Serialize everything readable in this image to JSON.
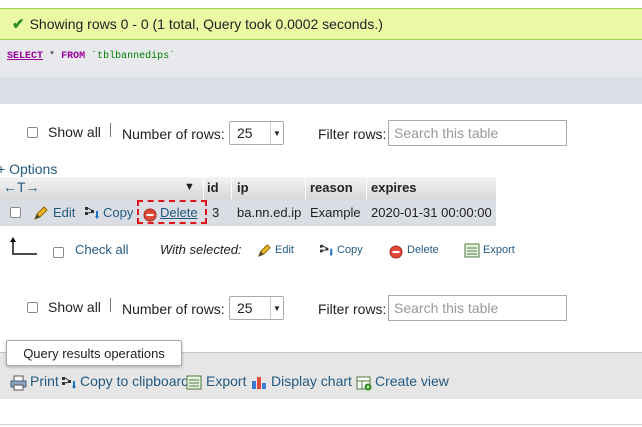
{
  "message": {
    "text": "Showing rows 0 - 0 (1 total, Query took 0.0002 seconds.)"
  },
  "sql": {
    "select": "SELECT",
    "star": "*",
    "from": "FROM",
    "table": "`tblbannedips`"
  },
  "controls_top": {
    "show_all": "Show all",
    "rows_label": "Number of rows:",
    "rows_value": "25",
    "filter_label": "Filter rows:",
    "search_placeholder": "Search this table"
  },
  "options_link": "+ Options",
  "table": {
    "sort_nav": "←T→",
    "columns": [
      "id",
      "ip",
      "reason",
      "expires"
    ],
    "row": {
      "edit": "Edit",
      "copy": "Copy",
      "delete": "Delete",
      "id": "3",
      "ip": "ba.nn.ed.ip",
      "reason": "Example",
      "expires": "2020-01-31 00:00:00"
    }
  },
  "bulk": {
    "check_all": "Check all",
    "with_selected": "With selected:",
    "edit": "Edit",
    "copy": "Copy",
    "delete": "Delete",
    "export": "Export"
  },
  "controls_bottom": {
    "show_all": "Show all",
    "rows_label": "Number of rows:",
    "rows_value": "25",
    "filter_label": "Filter rows:",
    "search_placeholder": "Search this table"
  },
  "operations": {
    "title": "Query results operations",
    "print": "Print",
    "copy_clipboard": "Copy to clipboard",
    "export": "Export",
    "display_chart": "Display chart",
    "create_view": "Create view"
  },
  "colors": {
    "success_bg": "#ebf8a4",
    "link": "#235a81",
    "highlight": "#e0141b"
  }
}
